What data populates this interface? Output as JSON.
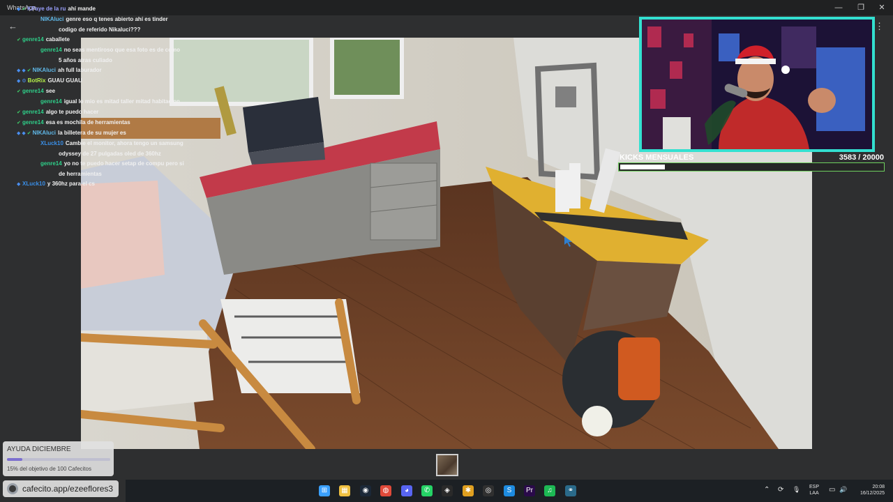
{
  "window": {
    "title": "WhatsApp",
    "minimize": "—",
    "maximize": "❐",
    "close": "✕",
    "back": "←",
    "more": "⋮"
  },
  "chat": [
    {
      "badges": [
        "◆",
        "✔"
      ],
      "user": "KPaye de la ru",
      "user_color": "#9aa0ff",
      "text": "ahí mande"
    },
    {
      "badges": [
        "◆",
        "◆",
        "✔"
      ],
      "user": "NIKAluci",
      "user_color": "#5fb8e8",
      "text": "genre eso q tenes abierto ahí es tinder codigo de referido Nikaluci???"
    },
    {
      "badges": [
        "✔"
      ],
      "user": "genre14",
      "user_color": "#2fd08a",
      "text": "caballete"
    },
    {
      "badges": [
        "✔"
      ],
      "user": "genre14",
      "user_color": "#2fd08a",
      "text": "no seas mentiroso que esa foto es de como 5 años atras culiado"
    },
    {
      "badges": [
        "◆",
        "◆",
        "✔"
      ],
      "user": "NIKAluci",
      "user_color": "#5fb8e8",
      "text": "ah full laburador"
    },
    {
      "badges": [
        "◆",
        "⚙"
      ],
      "user": "BotRix",
      "user_color": "#b6f04a",
      "text": "GUAU GUAU"
    },
    {
      "badges": [
        "✔"
      ],
      "user": "genre14",
      "user_color": "#2fd08a",
      "text": "see"
    },
    {
      "badges": [
        "✔"
      ],
      "user": "genre14",
      "user_color": "#2fd08a",
      "text": "igual lo mio es mitad taller mitad habitacion"
    },
    {
      "badges": [
        "✔"
      ],
      "user": "genre14",
      "user_color": "#2fd08a",
      "text": "algo te puedo hacer"
    },
    {
      "badges": [
        "✔"
      ],
      "user": "genre14",
      "user_color": "#2fd08a",
      "text": "esa es mochila de herramientas"
    },
    {
      "badges": [
        "◆",
        "◆",
        "✔"
      ],
      "user": "NIKAluci",
      "user_color": "#5fb8e8",
      "text": "la billetera de su mujer es"
    },
    {
      "badges": [
        "◆"
      ],
      "user": "XLuck10",
      "user_color": "#3a8fe8",
      "text": "Cambie el monitor, ahora tengo un samsung odyssey de 27 pulgadas oled de 360hz"
    },
    {
      "badges": [
        "✔"
      ],
      "user": "genre14",
      "user_color": "#2fd08a",
      "text": "yo no te puedo hacer setap de compu pero si de herramientas"
    },
    {
      "badges": [
        "◆"
      ],
      "user": "XLuck10",
      "user_color": "#3a8fe8",
      "text": "y 360hz para el cs"
    }
  ],
  "kicks": {
    "label": "KICKS MENSUALES",
    "current": "3583",
    "goal": " / 20000",
    "progress": 0.179
  },
  "ayuda": {
    "title": "AYUDA DICIEMBRE",
    "subtitle": "15% del objetivo de 100 Cafecitos",
    "progress": 0.15
  },
  "cafecito": {
    "text": "cafecito.app/ezeeflores3"
  },
  "taskbar": {
    "apps": [
      {
        "name": "windows-start-icon",
        "glyph": "⊞",
        "color": "#3aa0ff"
      },
      {
        "name": "file-explorer-icon",
        "glyph": "▦",
        "color": "#f0c040"
      },
      {
        "name": "steam-icon",
        "glyph": "◉",
        "color": "#1b2838"
      },
      {
        "name": "chrome-icon",
        "glyph": "◍",
        "color": "#e04a3a"
      },
      {
        "name": "discord-icon",
        "glyph": "◕",
        "color": "#5865f2"
      },
      {
        "name": "whatsapp-icon",
        "glyph": "✆",
        "color": "#25d366"
      },
      {
        "name": "shield-app-icon",
        "glyph": "◈",
        "color": "#2a2a2a"
      },
      {
        "name": "bolt-app-icon",
        "glyph": "✱",
        "color": "#e0a020"
      },
      {
        "name": "obs-icon",
        "glyph": "◎",
        "color": "#303030"
      },
      {
        "name": "skype-icon",
        "glyph": "S",
        "color": "#1d8be0"
      },
      {
        "name": "premiere-icon",
        "glyph": "Pr",
        "color": "#2a0a4a"
      },
      {
        "name": "spotify-icon",
        "glyph": "♫",
        "color": "#1db954"
      },
      {
        "name": "link-app-icon",
        "glyph": "⚭",
        "color": "#2a6a8a"
      }
    ],
    "tray": {
      "chevron": "⌃",
      "sync": "⟳",
      "mic": "🎙",
      "lang_top": "ESP",
      "lang_bottom": "LAA",
      "monitor": "▭",
      "volume": "🔊",
      "time": "20:08",
      "date": "16/12/2025"
    }
  }
}
